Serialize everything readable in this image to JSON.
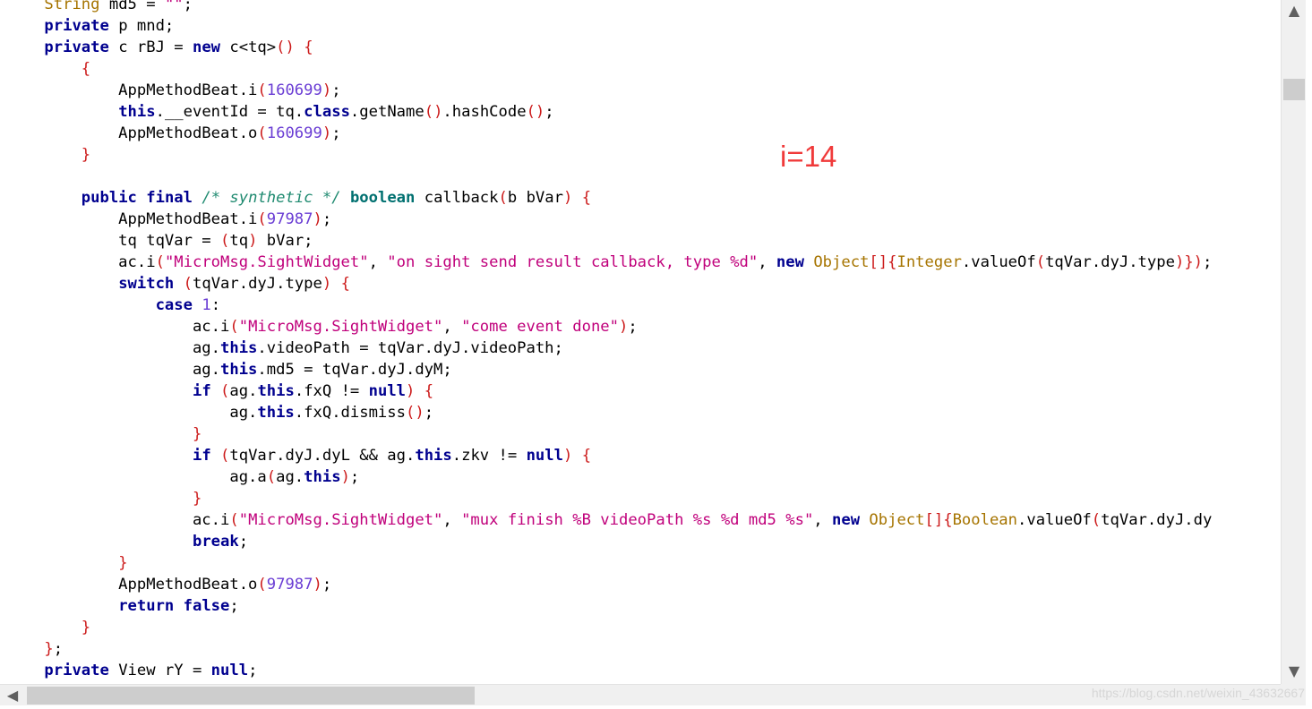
{
  "annotation": "i=14",
  "watermark": "https://blog.csdn.net/weixin_43632667",
  "scrollbars": {
    "up_icon": "▲",
    "down_icon": "▼",
    "left_icon": "◀",
    "right_icon": "▶"
  },
  "code_lines": [
    [
      [
        "    ",
        ""
      ],
      [
        "String",
        "type"
      ],
      [
        " md5 = ",
        ""
      ],
      [
        "\"\"",
        "str"
      ],
      [
        ";",
        ""
      ]
    ],
    [
      [
        "    ",
        ""
      ],
      [
        "private",
        "kw"
      ],
      [
        " p mnd;",
        ""
      ]
    ],
    [
      [
        "    ",
        ""
      ],
      [
        "private",
        "kw"
      ],
      [
        " c rBJ = ",
        ""
      ],
      [
        "new",
        "kw"
      ],
      [
        " c<tq>",
        ""
      ],
      [
        "()",
        "punc"
      ],
      [
        " ",
        ""
      ],
      [
        "{",
        "punc"
      ]
    ],
    [
      [
        "        ",
        ""
      ],
      [
        "{",
        "punc"
      ]
    ],
    [
      [
        "            AppMethodBeat.i",
        ""
      ],
      [
        "(",
        "punc"
      ],
      [
        "160699",
        "num"
      ],
      [
        ")",
        "punc"
      ],
      [
        ";",
        ""
      ]
    ],
    [
      [
        "            ",
        ""
      ],
      [
        "this",
        "kw"
      ],
      [
        ".__eventId = tq.",
        ""
      ],
      [
        "class",
        "kw"
      ],
      [
        ".getName",
        ""
      ],
      [
        "()",
        "punc"
      ],
      [
        ".hashCode",
        ""
      ],
      [
        "()",
        "punc"
      ],
      [
        ";",
        ""
      ]
    ],
    [
      [
        "            AppMethodBeat.o",
        ""
      ],
      [
        "(",
        "punc"
      ],
      [
        "160699",
        "num"
      ],
      [
        ")",
        "punc"
      ],
      [
        ";",
        ""
      ]
    ],
    [
      [
        "        ",
        ""
      ],
      [
        "}",
        "punc"
      ]
    ],
    [
      [
        "",
        ""
      ]
    ],
    [
      [
        "        ",
        ""
      ],
      [
        "public",
        "kw"
      ],
      [
        " ",
        ""
      ],
      [
        "final",
        "kw"
      ],
      [
        " ",
        ""
      ],
      [
        "/* synthetic */",
        "cmt"
      ],
      [
        " ",
        ""
      ],
      [
        "boolean",
        "kw2"
      ],
      [
        " callback",
        ""
      ],
      [
        "(",
        "punc"
      ],
      [
        "b bVar",
        ""
      ],
      [
        ")",
        "punc"
      ],
      [
        " ",
        ""
      ],
      [
        "{",
        "punc"
      ]
    ],
    [
      [
        "            AppMethodBeat.i",
        ""
      ],
      [
        "(",
        "punc"
      ],
      [
        "97987",
        "num"
      ],
      [
        ")",
        "punc"
      ],
      [
        ";",
        ""
      ]
    ],
    [
      [
        "            tq tqVar = ",
        ""
      ],
      [
        "(",
        "punc"
      ],
      [
        "tq",
        ""
      ],
      [
        ")",
        "punc"
      ],
      [
        " bVar;",
        ""
      ]
    ],
    [
      [
        "            ac.i",
        ""
      ],
      [
        "(",
        "punc"
      ],
      [
        "\"MicroMsg.SightWidget\"",
        "str"
      ],
      [
        ", ",
        ""
      ],
      [
        "\"on sight send result callback, type %d\"",
        "str"
      ],
      [
        ", ",
        ""
      ],
      [
        "new",
        "kw"
      ],
      [
        " ",
        ""
      ],
      [
        "Object",
        "type"
      ],
      [
        "[]",
        "punc"
      ],
      [
        "{",
        "punc"
      ],
      [
        "Integer",
        "type"
      ],
      [
        ".valueOf",
        ""
      ],
      [
        "(",
        "punc"
      ],
      [
        "tqVar.dyJ.type",
        ""
      ],
      [
        ")",
        "punc"
      ],
      [
        "})",
        "punc"
      ],
      [
        ";",
        ""
      ]
    ],
    [
      [
        "            ",
        ""
      ],
      [
        "switch",
        "kw"
      ],
      [
        " ",
        ""
      ],
      [
        "(",
        "punc"
      ],
      [
        "tqVar.dyJ.type",
        ""
      ],
      [
        ")",
        "punc"
      ],
      [
        " ",
        ""
      ],
      [
        "{",
        "punc"
      ]
    ],
    [
      [
        "                ",
        ""
      ],
      [
        "case",
        "kw"
      ],
      [
        " ",
        ""
      ],
      [
        "1",
        "num"
      ],
      [
        ":",
        ""
      ]
    ],
    [
      [
        "                    ac.i",
        ""
      ],
      [
        "(",
        "punc"
      ],
      [
        "\"MicroMsg.SightWidget\"",
        "str"
      ],
      [
        ", ",
        ""
      ],
      [
        "\"come event done\"",
        "str"
      ],
      [
        ")",
        "punc"
      ],
      [
        ";",
        ""
      ]
    ],
    [
      [
        "                    ag.",
        ""
      ],
      [
        "this",
        "kw"
      ],
      [
        ".videoPath = tqVar.dyJ.videoPath;",
        ""
      ]
    ],
    [
      [
        "                    ag.",
        ""
      ],
      [
        "this",
        "kw"
      ],
      [
        ".md5 = tqVar.dyJ.dyM;",
        ""
      ]
    ],
    [
      [
        "                    ",
        ""
      ],
      [
        "if",
        "kw"
      ],
      [
        " ",
        ""
      ],
      [
        "(",
        "punc"
      ],
      [
        "ag.",
        ""
      ],
      [
        "this",
        "kw"
      ],
      [
        ".fxQ != ",
        ""
      ],
      [
        "null",
        "kw"
      ],
      [
        ")",
        "punc"
      ],
      [
        " ",
        ""
      ],
      [
        "{",
        "punc"
      ]
    ],
    [
      [
        "                        ag.",
        ""
      ],
      [
        "this",
        "kw"
      ],
      [
        ".fxQ.dismiss",
        ""
      ],
      [
        "()",
        "punc"
      ],
      [
        ";",
        ""
      ]
    ],
    [
      [
        "                    ",
        ""
      ],
      [
        "}",
        "punc"
      ]
    ],
    [
      [
        "                    ",
        ""
      ],
      [
        "if",
        "kw"
      ],
      [
        " ",
        ""
      ],
      [
        "(",
        "punc"
      ],
      [
        "tqVar.dyJ.dyL && ag.",
        ""
      ],
      [
        "this",
        "kw"
      ],
      [
        ".zkv != ",
        ""
      ],
      [
        "null",
        "kw"
      ],
      [
        ")",
        "punc"
      ],
      [
        " ",
        ""
      ],
      [
        "{",
        "punc"
      ]
    ],
    [
      [
        "                        ag.a",
        ""
      ],
      [
        "(",
        "punc"
      ],
      [
        "ag.",
        ""
      ],
      [
        "this",
        "kw"
      ],
      [
        ")",
        "punc"
      ],
      [
        ";",
        ""
      ]
    ],
    [
      [
        "                    ",
        ""
      ],
      [
        "}",
        "punc"
      ]
    ],
    [
      [
        "                    ac.i",
        ""
      ],
      [
        "(",
        "punc"
      ],
      [
        "\"MicroMsg.SightWidget\"",
        "str"
      ],
      [
        ", ",
        ""
      ],
      [
        "\"mux finish %B videoPath %s %d md5 %s\"",
        "str"
      ],
      [
        ", ",
        ""
      ],
      [
        "new",
        "kw"
      ],
      [
        " ",
        ""
      ],
      [
        "Object",
        "type"
      ],
      [
        "[]",
        "punc"
      ],
      [
        "{",
        "punc"
      ],
      [
        "Boolean",
        "type"
      ],
      [
        ".valueOf",
        ""
      ],
      [
        "(",
        "punc"
      ],
      [
        "tqVar.dyJ.dy",
        ""
      ]
    ],
    [
      [
        "                    ",
        ""
      ],
      [
        "break",
        "kw"
      ],
      [
        ";",
        ""
      ]
    ],
    [
      [
        "            ",
        ""
      ],
      [
        "}",
        "punc"
      ]
    ],
    [
      [
        "            AppMethodBeat.o",
        ""
      ],
      [
        "(",
        "punc"
      ],
      [
        "97987",
        "num"
      ],
      [
        ")",
        "punc"
      ],
      [
        ";",
        ""
      ]
    ],
    [
      [
        "            ",
        ""
      ],
      [
        "return",
        "kw"
      ],
      [
        " ",
        ""
      ],
      [
        "false",
        "kw"
      ],
      [
        ";",
        ""
      ]
    ],
    [
      [
        "        ",
        ""
      ],
      [
        "}",
        "punc"
      ]
    ],
    [
      [
        "    ",
        ""
      ],
      [
        "}",
        "punc"
      ],
      [
        ";",
        ""
      ]
    ],
    [
      [
        "    ",
        ""
      ],
      [
        "private",
        "kw"
      ],
      [
        " View rY = ",
        ""
      ],
      [
        "null",
        "kw"
      ],
      [
        ";",
        ""
      ]
    ]
  ]
}
